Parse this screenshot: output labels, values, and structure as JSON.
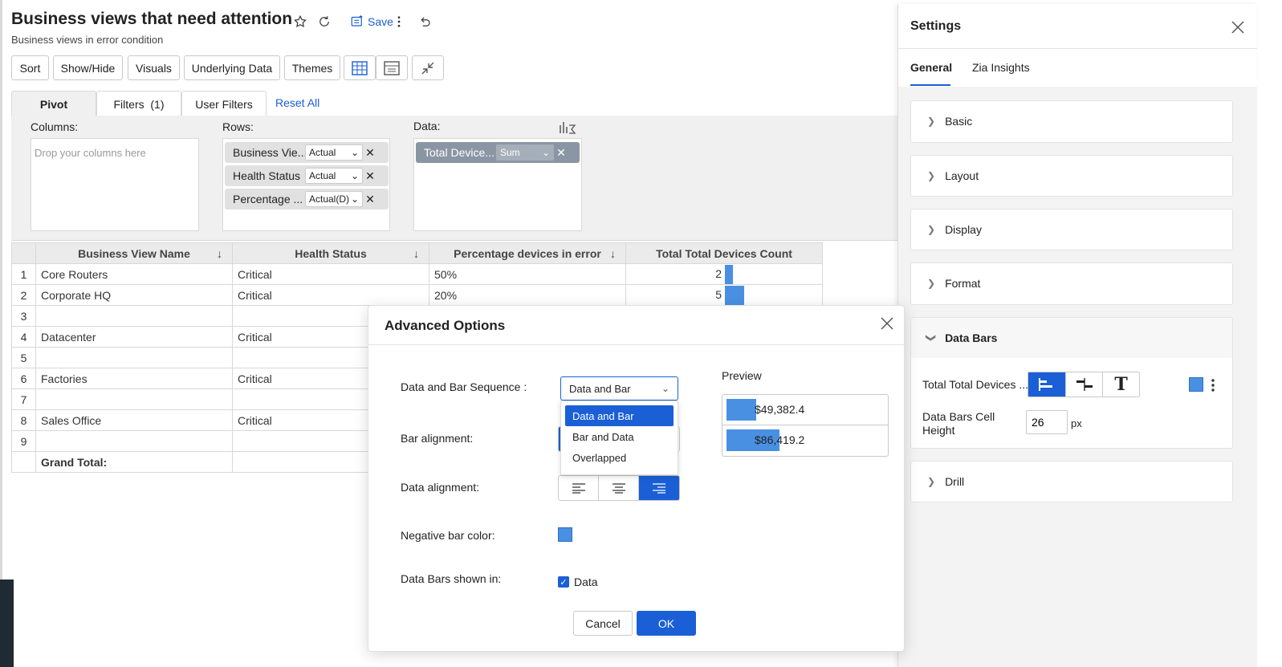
{
  "header": {
    "title": "Business views that need attention",
    "subtitle": "Business views in error condition",
    "save_label": "Save"
  },
  "toolbar": {
    "sort": "Sort",
    "showhide": "Show/Hide",
    "visuals": "Visuals",
    "underlying": "Underlying Data",
    "themes": "Themes"
  },
  "pivot": {
    "tab_pivot": "Pivot",
    "tab_filters": "Filters  (1)",
    "tab_user_filters": "User Filters",
    "reset_all": "Reset All",
    "columns_label": "Columns:",
    "columns_hint": "Drop your columns here",
    "rows_label": "Rows:",
    "data_label": "Data:",
    "rows": [
      {
        "name": "Business Vie...",
        "agg": "Actual"
      },
      {
        "name": "Health Status",
        "agg": "Actual"
      },
      {
        "name": "Percentage ...",
        "agg": "Actual(D)"
      }
    ],
    "data": [
      {
        "name": "Total Device...",
        "agg": "Sum"
      }
    ]
  },
  "table": {
    "headers": [
      "Business View Name",
      "Health Status",
      "Percentage devices in error",
      "Total Total Devices Count"
    ],
    "rows": [
      {
        "n": "1",
        "name": "Core Routers",
        "status": "Critical",
        "pct": "50%",
        "count": "2",
        "bar": 0.08
      },
      {
        "n": "2",
        "name": "Corporate HQ",
        "status": "Critical",
        "pct": "20%",
        "count": "5",
        "bar": 0.2
      },
      {
        "n": "3",
        "name": "",
        "status": "",
        "pct": "",
        "count": "",
        "bar": 0
      },
      {
        "n": "4",
        "name": "Datacenter",
        "status": "Critical",
        "pct": "",
        "count": "",
        "bar": 0
      },
      {
        "n": "5",
        "name": "",
        "status": "",
        "pct": "",
        "count": "",
        "bar": 0
      },
      {
        "n": "6",
        "name": "Factories",
        "status": "Critical",
        "pct": "",
        "count": "",
        "bar": 0
      },
      {
        "n": "7",
        "name": "",
        "status": "",
        "pct": "",
        "count": "",
        "bar": 0
      },
      {
        "n": "8",
        "name": "Sales Office",
        "status": "Critical",
        "pct": "",
        "count": "",
        "bar": 0
      },
      {
        "n": "9",
        "name": "",
        "status": "",
        "pct": "",
        "count": "",
        "bar": 0
      }
    ],
    "grand_total": "Grand Total:"
  },
  "settings": {
    "title": "Settings",
    "tab_general": "General",
    "tab_zia": "Zia Insights",
    "sections": [
      "Basic",
      "Layout",
      "Display",
      "Format"
    ],
    "databars_title": "Data Bars",
    "databars_field": "Total Total Devices ...",
    "cell_height_label": "Data Bars Cell Height",
    "cell_height_value": "26",
    "cell_height_unit": "px",
    "drill": "Drill",
    "bar_color": "#4a90e2"
  },
  "modal": {
    "title": "Advanced Options",
    "sequence_label": "Data and Bar Sequence :",
    "sequence_value": "Data and Bar",
    "sequence_options": [
      "Data and Bar",
      "Bar and Data",
      "Overlapped"
    ],
    "bar_alignment_label": "Bar alignment:",
    "data_alignment_label": "Data alignment:",
    "negative_color_label": "Negative bar color:",
    "shown_in_label": "Data Bars shown in:",
    "shown_in_option": "Data",
    "preview_label": "Preview",
    "preview_values": [
      {
        "text": "$49,382.4",
        "bar": 0.36
      },
      {
        "text": "$86,419.2",
        "bar": 0.63
      }
    ],
    "cancel": "Cancel",
    "ok": "OK"
  },
  "colors": {
    "accent": "#1a5fd6",
    "bar": "#4a90e2"
  }
}
